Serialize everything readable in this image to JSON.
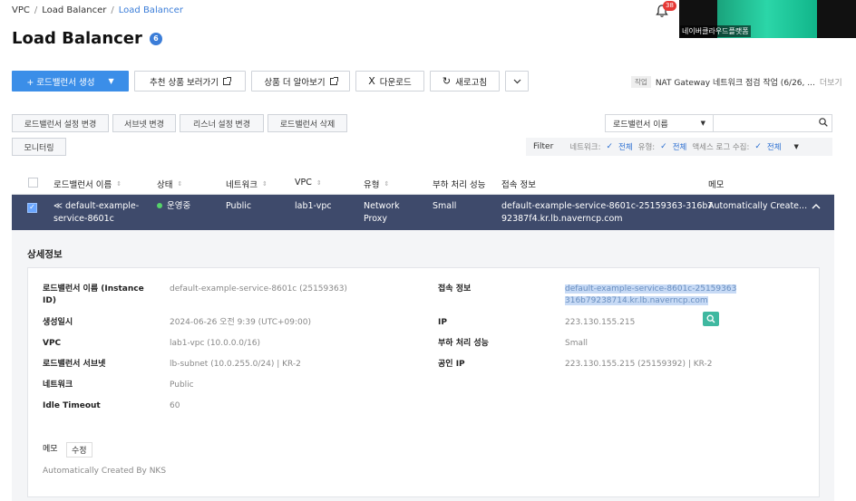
{
  "breadcrumb": {
    "items": [
      "VPC",
      "Load Balancer"
    ],
    "current": "Load Balancer"
  },
  "page": {
    "title": "Load Balancer",
    "count": "6"
  },
  "notifications": {
    "count": "38"
  },
  "video": {
    "label": "네이버클라우드플랫폼"
  },
  "toolbar": {
    "create_label": "+ 로드밸런서 생성",
    "recommend_label": "추천 상품 보러가기",
    "learn_more_label": "상품 더 알아보기",
    "download_label": "다운로드",
    "refresh_label": "새로고침"
  },
  "task": {
    "tag": "작업",
    "text": "NAT Gateway 네트워크 점검 작업 (6/26, ...",
    "more": "더보기"
  },
  "actions": {
    "lb_setting": "로드밸런서 설정 변경",
    "subnet_change": "서브넷 변경",
    "listener_change": "리스너 설정 변경",
    "lb_delete": "로드밸런서 삭제",
    "monitoring": "모니터링"
  },
  "search": {
    "select_value": "로드밸런서 이름"
  },
  "filter": {
    "title": "Filter",
    "network_label": "네트워크:",
    "network_value": "전체",
    "type_label": "유형:",
    "type_value": "전체",
    "access_log_label": "액세스 로그 수집:",
    "access_log_value": "전체"
  },
  "table": {
    "headers": [
      "로드밸런서 이름",
      "상태",
      "네트워크",
      "VPC",
      "유형",
      "부하 처리 성능",
      "접속 정보",
      "메모"
    ],
    "row": {
      "name_line1": "default-example-",
      "name_line2": "service-8601c",
      "status": "운영중",
      "network": "Public",
      "vpc": "lab1-vpc",
      "type_line1": "Network",
      "type_line2": "Proxy",
      "performance": "Small",
      "access_line1": "default-example-service-8601c-25159363-316b7",
      "access_line2": "92387f4.kr.lb.naverncp.com",
      "memo": "Automatically Create..."
    }
  },
  "details": {
    "title": "상세정보",
    "name_label_line1": "로드밸런서 이름 (Instance",
    "name_label_line2": "ID)",
    "name_value": "default-example-service-8601c (25159363)",
    "created_label": "생성일시",
    "created_value": "2024-06-26 오전 9:39 (UTC+09:00)",
    "vpc_label": "VPC",
    "vpc_value": "lab1-vpc (10.0.0.0/16)",
    "subnet_label": "로드밸런서 서브넷",
    "subnet_value": "lb-subnet (10.0.255.0/24) | KR-2",
    "network_label": "네트워크",
    "network_value": "Public",
    "idle_label": "Idle Timeout",
    "idle_value": "60",
    "access_label": "접속 정보",
    "access_value_line1": "default-example-service-8601c-25159363",
    "access_value_line2": "316b79238714.kr.lb.naverncp.com",
    "ip_label": "IP",
    "ip_value": "223.130.155.215",
    "perf_label": "부하 처리 성능",
    "perf_value": "Small",
    "public_ip_label": "공인 IP",
    "public_ip_value": "223.130.155.215 (25159392) | KR-2",
    "memo_label": "메모",
    "memo_edit": "수정",
    "memo_value": "Automatically Created By NKS"
  },
  "colors": {
    "primary": "#3b8ee8",
    "selected_row": "#3e4a6b",
    "link": "#3b7dd8",
    "status_green": "#55d36a"
  }
}
